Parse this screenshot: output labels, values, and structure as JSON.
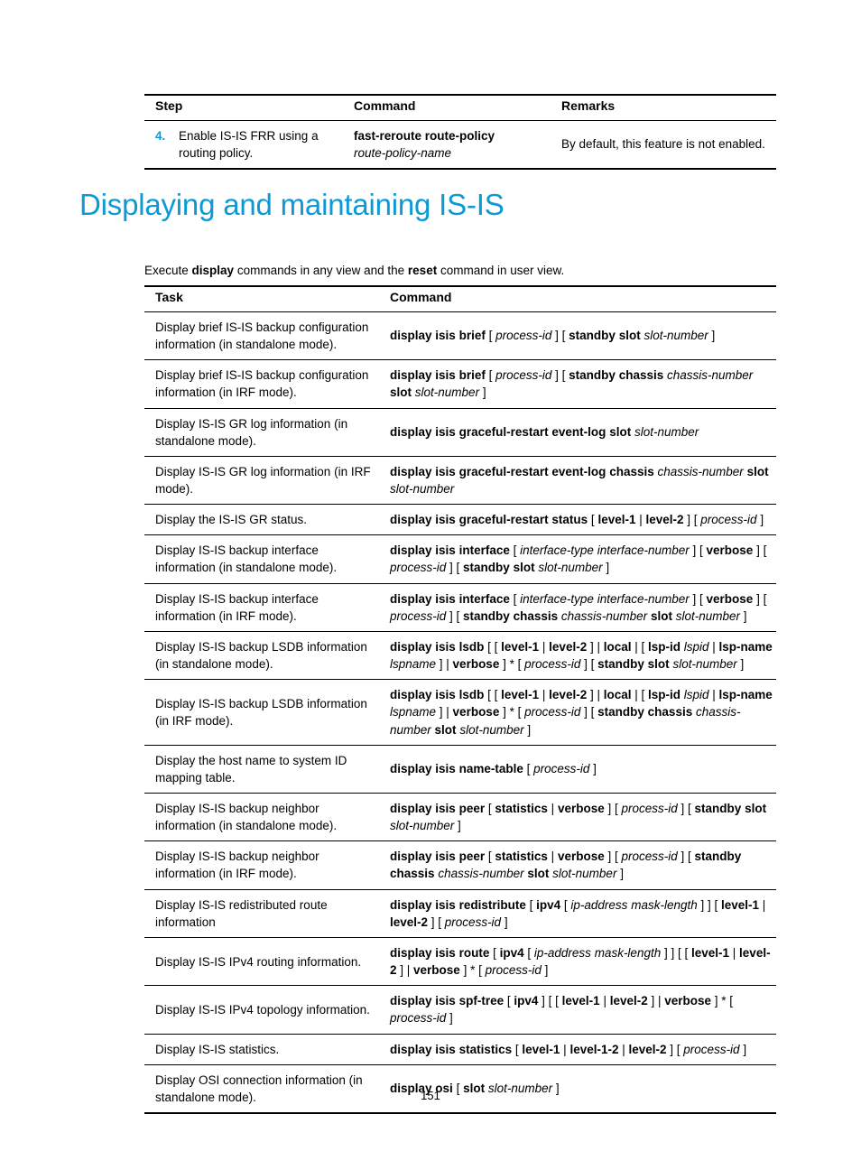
{
  "theme": {
    "accent_color": "#0c9ad7",
    "text_color": "#000000",
    "page_background": "#ffffff"
  },
  "step_table": {
    "headers": {
      "step": "Step",
      "command": "Command",
      "remarks": "Remarks"
    },
    "rows": [
      {
        "number": "4.",
        "step": "Enable IS-IS FRR using a routing policy.",
        "command_bold": "fast-reroute route-policy",
        "command_italic": "route-policy-name",
        "remarks": "By default, this feature is not enabled."
      }
    ]
  },
  "heading": "Displaying and maintaining IS-IS",
  "intro": {
    "part1": "Execute ",
    "bold1": "display",
    "part2": " commands in any view and the ",
    "bold2": "reset",
    "part3": " command in user view."
  },
  "task_table": {
    "headers": {
      "task": "Task",
      "command": "Command"
    },
    "rows": [
      {
        "task": "Display brief IS-IS backup configuration information (in standalone mode).",
        "command": "display isis brief [ process-id ] [ standby slot slot-number ]"
      },
      {
        "task": "Display brief IS-IS backup configuration information (in IRF mode).",
        "command": "display isis brief [ process-id ] [ standby chassis chassis-number slot slot-number ]"
      },
      {
        "task": "Display IS-IS GR log information (in standalone mode).",
        "command": "display isis graceful-restart event-log slot slot-number"
      },
      {
        "task": "Display IS-IS GR log information (in IRF mode).",
        "command": "display isis graceful-restart event-log chassis chassis-number slot slot-number"
      },
      {
        "task": "Display the IS-IS GR status.",
        "command": "display isis graceful-restart status [ level-1 | level-2 ] [ process-id ]"
      },
      {
        "task": "Display IS-IS backup interface information (in standalone mode).",
        "command": "display isis interface [ interface-type interface-number ] [ verbose ] [ process-id ] [ standby slot slot-number ]"
      },
      {
        "task": "Display IS-IS backup interface information (in IRF mode).",
        "command": "display isis interface [ interface-type interface-number ] [ verbose ] [ process-id ] [ standby chassis chassis-number slot slot-number ]"
      },
      {
        "task": "Display IS-IS backup LSDB information (in standalone mode).",
        "command": "display isis lsdb [ [ level-1 | level-2 ] | local | [ lsp-id lspid | lsp-name lspname ] | verbose ] * [ process-id ] [ standby slot slot-number ]"
      },
      {
        "task": "Display IS-IS backup LSDB information (in IRF mode).",
        "command": "display isis lsdb [ [ level-1 | level-2 ] | local | [ lsp-id lspid | lsp-name lspname ] | verbose ] * [ process-id ] [ standby chassis chassis-number slot slot-number ]"
      },
      {
        "task": "Display the host name to system ID mapping table.",
        "command": "display isis name-table [ process-id ]"
      },
      {
        "task": "Display IS-IS backup neighbor information (in standalone mode).",
        "command": "display isis peer [ statistics | verbose ] [ process-id ] [ standby slot slot-number ]"
      },
      {
        "task": "Display IS-IS backup neighbor information (in IRF mode).",
        "command": "display isis peer [ statistics | verbose ] [ process-id ] [ standby chassis chassis-number slot slot-number ]"
      },
      {
        "task": "Display IS-IS redistributed route information",
        "command": "display isis redistribute [ ipv4 [ ip-address mask-length ] ] [ level-1 | level-2 ] [ process-id ]"
      },
      {
        "task": "Display IS-IS IPv4 routing information.",
        "command": "display isis route [ ipv4 [ ip-address mask-length ] ] [ [ level-1 | level-2 ] | verbose ] * [ process-id ]"
      },
      {
        "task": "Display IS-IS IPv4 topology information.",
        "command": "display isis spf-tree [ ipv4 ] [ [ level-1 | level-2 ] | verbose ] * [ process-id ]"
      },
      {
        "task": "Display IS-IS statistics.",
        "command": "display isis statistics [ level-1 | level-1-2 | level-2 ] [ process-id ]"
      },
      {
        "task": "Display OSI connection information (in standalone mode).",
        "command": "display osi [ slot slot-number ]"
      }
    ]
  },
  "footer": {
    "page_number": "151"
  }
}
